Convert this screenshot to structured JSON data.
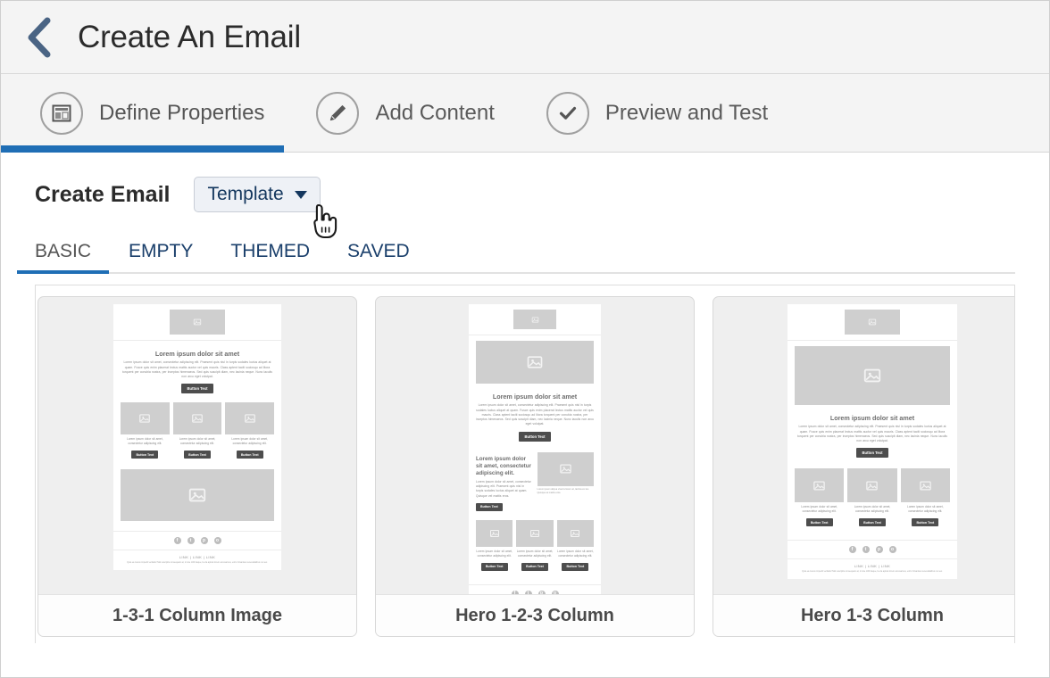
{
  "titlebar": {
    "back_icon": "chevron-left-icon",
    "title": "Create An Email"
  },
  "steps": [
    {
      "label": "Define Properties",
      "icon": "layout-properties-icon",
      "active": true
    },
    {
      "label": "Add Content",
      "icon": "pencil-icon",
      "active": false
    },
    {
      "label": "Preview and Test",
      "icon": "check-circle-icon",
      "active": false
    }
  ],
  "toolbar": {
    "create_title": "Create Email",
    "template_button": "Template",
    "caret_icon": "caret-down-icon",
    "cursor_icon": "pointing-hand-cursor"
  },
  "tabs": [
    {
      "label": "BASIC",
      "selected": true
    },
    {
      "label": "EMPTY",
      "selected": false
    },
    {
      "label": "THEMED",
      "selected": false
    },
    {
      "label": "SAVED",
      "selected": false
    }
  ],
  "cards": [
    {
      "label": "1-3-1 Column Image"
    },
    {
      "label": "Hero 1-2-3 Column"
    },
    {
      "label": "Hero 1-3 Column"
    }
  ],
  "mock": {
    "heading": "Lorem ipsum dolor sit amet",
    "heading_left": "Lorem ipsum dolor sit amet, consectetur adipiscing elit.",
    "body": "Lorem ipsum dolor sit amet, consectetur adipiscing elit. Praesent quis nisl in turpis sodales luctus aliquet at quam. Fusce quis enim placerat lectus mattis auctor vel quis mauris. Class aptent taciti sociosqu ad litora torquent per conubia nostra, per inceptos himenaeos. Sed quis suscipit diam, nec lacinia neque. Nunc iaculis non arcu eget volutpat.",
    "body_short": "Lorem ipsum dolor sit amet, consectetur adipiscing elit. Praesent quis nisl in turpis sodales luctus aliquet at quam. Quisque vel mattis eros.",
    "col_text": "Lorem ipsum dolor sit amet, consectetur adipiscing elit.",
    "caption": "Lorem ipsum aliqua viverra lorem at, lacinia ex leo. Quisque at mattis eros.",
    "button": "Button Text",
    "links": "LINK  |  LINK  |  LINK",
    "fineprint": "Quis ea metus impedit veritatis! Nisl suscipits consequam at, in iste nihil itaque, la via apicat lorem accusamus, enim forsantas necessitatibus no sex.",
    "image_icon": "image-placeholder-icon",
    "logo_icon": "logo-placeholder-icon",
    "social_icons": [
      "facebook-icon",
      "twitter-icon",
      "pinterest-icon",
      "instagram-icon"
    ]
  },
  "colors": {
    "accent": "#1f6eb5",
    "link": "#1a3f6b",
    "back_chevron": "#4a6484",
    "header_bg": "#f4f4f4",
    "card_bg": "#efefef"
  }
}
